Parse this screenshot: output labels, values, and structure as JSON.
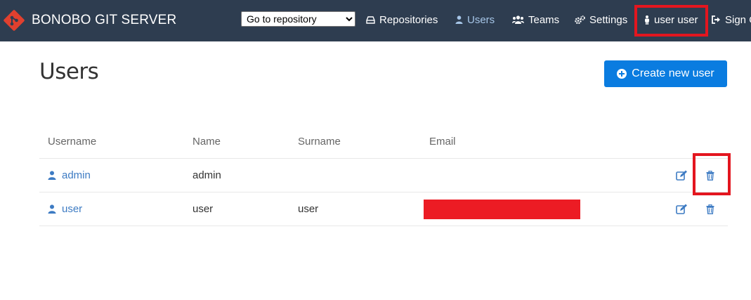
{
  "navbar": {
    "brand": "BONOBO GIT SERVER",
    "repo_select": {
      "selected": "Go to repository",
      "options": [
        "Go to repository"
      ]
    },
    "items": [
      {
        "label": "Repositories",
        "icon": "repositories-icon"
      },
      {
        "label": "Users",
        "icon": "user-icon"
      },
      {
        "label": "Teams",
        "icon": "teams-icon"
      },
      {
        "label": "Settings",
        "icon": "settings-icon"
      },
      {
        "label": "user user",
        "icon": "person-icon"
      },
      {
        "label": "Sign Out",
        "icon": "sign-out-icon"
      }
    ]
  },
  "page": {
    "title": "Users",
    "create_button": "Create new user"
  },
  "table": {
    "columns": [
      "Username",
      "Name",
      "Surname",
      "Email"
    ],
    "rows": [
      {
        "username": "admin",
        "name": "admin",
        "surname": "",
        "email": ""
      },
      {
        "username": "user",
        "name": "user",
        "surname": "user",
        "email": ""
      }
    ]
  },
  "colors": {
    "navbar_bg": "#2e3d50",
    "accent": "#0a7ce0",
    "link": "#3d7bc3",
    "highlight": "#e3161f",
    "redaction": "#ec1c24"
  }
}
